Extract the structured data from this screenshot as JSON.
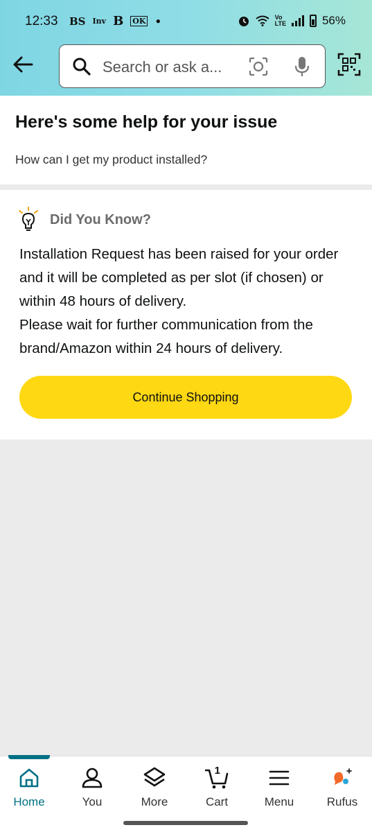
{
  "status": {
    "time": "12:33",
    "left_icons": [
      "BS",
      "Inv",
      "B",
      "OK",
      "•"
    ],
    "battery": "56%"
  },
  "search": {
    "placeholder": "Search or ask a..."
  },
  "help": {
    "title": "Here's some help for your issue",
    "question": "How can I get my product installed?"
  },
  "card": {
    "heading": "Did You Know?",
    "body_line1": "Installation Request has been raised for your order and it will be completed as per slot (if chosen) or within 48 hours of delivery.",
    "body_line2": "Please wait for further communication from the brand/Amazon within 24 hours of delivery.",
    "button": "Continue Shopping"
  },
  "nav": {
    "items": [
      {
        "label": "Home",
        "icon": "home-icon",
        "active": true
      },
      {
        "label": "You",
        "icon": "person-icon",
        "active": false
      },
      {
        "label": "More",
        "icon": "layers-icon",
        "active": false
      },
      {
        "label": "Cart",
        "icon": "cart-icon",
        "active": false,
        "count": "1"
      },
      {
        "label": "Menu",
        "icon": "menu-icon",
        "active": false
      },
      {
        "label": "Rufus",
        "icon": "rufus-icon",
        "active": false
      }
    ]
  },
  "colors": {
    "accent": "#007185",
    "button": "#ffd814",
    "header_start": "#7fd6e3",
    "header_end": "#a6e6d6"
  }
}
